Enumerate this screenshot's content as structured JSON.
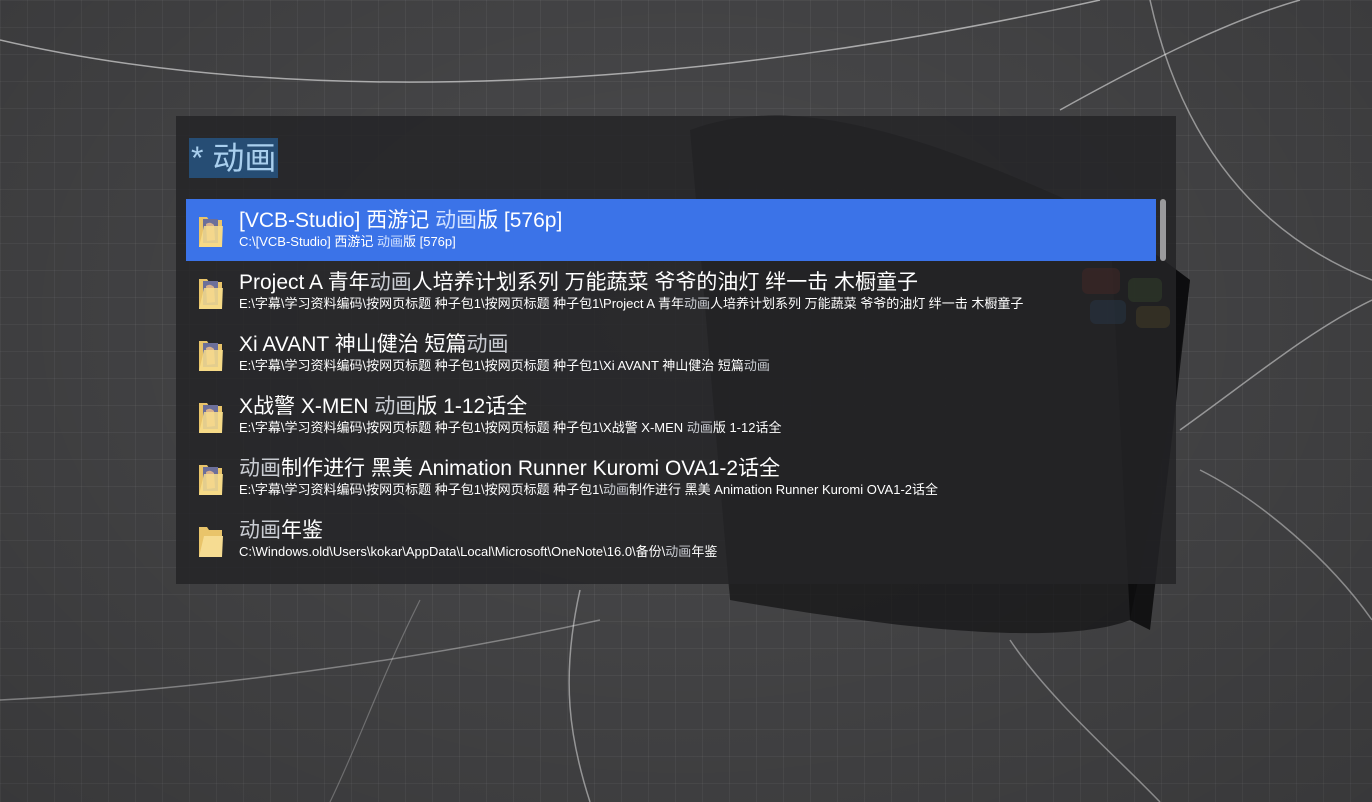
{
  "search": {
    "query": "* 动画"
  },
  "results": [
    {
      "icon": "folder-with-image-icon",
      "title_parts": [
        {
          "t": "[VCB-Studio] 西游记 ",
          "h": false
        },
        {
          "t": "动画",
          "h": true
        },
        {
          "t": "版 [576p]",
          "h": false
        }
      ],
      "path_parts": [
        {
          "t": "C:\\[VCB-Studio] 西游记 ",
          "h": false
        },
        {
          "t": "动画",
          "h": true
        },
        {
          "t": "版 [576p]",
          "h": false
        }
      ]
    },
    {
      "icon": "folder-with-image-icon",
      "title_parts": [
        {
          "t": "Project A 青年",
          "h": false
        },
        {
          "t": "动画",
          "h": true
        },
        {
          "t": "人培养计划系列 万能蔬菜 爷爷的油灯 绊一击 木橱童子",
          "h": false
        }
      ],
      "path_parts": [
        {
          "t": "E:\\字幕\\学习资料编码\\按网页标题 种子包1\\按网页标题 种子包1\\Project A 青年",
          "h": false
        },
        {
          "t": "动画",
          "h": true
        },
        {
          "t": "人培养计划系列 万能蔬菜 爷爷的油灯 绊一击 木橱童子",
          "h": false
        }
      ]
    },
    {
      "icon": "folder-with-image-icon",
      "title_parts": [
        {
          "t": "Xi AVANT 神山健治 短篇",
          "h": false
        },
        {
          "t": "动画",
          "h": true
        }
      ],
      "path_parts": [
        {
          "t": "E:\\字幕\\学习资料编码\\按网页标题 种子包1\\按网页标题 种子包1\\Xi AVANT 神山健治 短篇",
          "h": false
        },
        {
          "t": "动画",
          "h": true
        }
      ]
    },
    {
      "icon": "folder-with-image-icon",
      "title_parts": [
        {
          "t": "X战警 X-MEN ",
          "h": false
        },
        {
          "t": "动画",
          "h": true
        },
        {
          "t": "版 1-12话全",
          "h": false
        }
      ],
      "path_parts": [
        {
          "t": "E:\\字幕\\学习资料编码\\按网页标题 种子包1\\按网页标题 种子包1\\X战警 X-MEN ",
          "h": false
        },
        {
          "t": "动画",
          "h": true
        },
        {
          "t": "版 1-12话全",
          "h": false
        }
      ]
    },
    {
      "icon": "folder-with-image-icon",
      "title_parts": [
        {
          "t": "动画",
          "h": true
        },
        {
          "t": "制作进行 黑美 Animation Runner Kuromi OVA1-2话全",
          "h": false
        }
      ],
      "path_parts": [
        {
          "t": "E:\\字幕\\学习资料编码\\按网页标题 种子包1\\按网页标题 种子包1\\",
          "h": false
        },
        {
          "t": "动画",
          "h": true
        },
        {
          "t": "制作进行 黑美 Animation Runner Kuromi OVA1-2话全",
          "h": false
        }
      ]
    },
    {
      "icon": "folder-icon",
      "title_parts": [
        {
          "t": "动画",
          "h": true
        },
        {
          "t": "年鉴",
          "h": false
        }
      ],
      "path_parts": [
        {
          "t": "C:\\Windows.old\\Users\\kokar\\AppData\\Local\\Microsoft\\OneNote\\16.0\\备份\\",
          "h": false
        },
        {
          "t": "动画",
          "h": true
        },
        {
          "t": "年鉴",
          "h": false
        }
      ]
    }
  ],
  "selected_index": 0,
  "colors": {
    "selection": "#3b73e8",
    "query_highlight": "#264d74",
    "match_text": "#c9ccd2"
  }
}
